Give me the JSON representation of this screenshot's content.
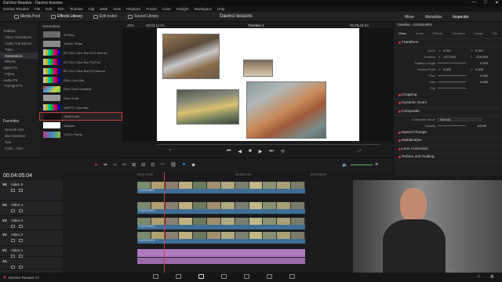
{
  "window": {
    "title": "DaVinci Resolve - Davinci lessons",
    "controls": [
      "—",
      "□",
      "✕"
    ]
  },
  "menu": [
    "DaVinci Resolve",
    "File",
    "Edit",
    "Trim",
    "Timeline",
    "Clip",
    "Mark",
    "View",
    "Playback",
    "Fusion",
    "Color",
    "Fairlight",
    "Workspace",
    "Help"
  ],
  "toolbar": {
    "media_pool": "Media Pool",
    "effects_library": "Effects Library",
    "edit_index": "Edit Index",
    "sound_library": "Sound Library",
    "project_title": "Davinci lessons",
    "mixer": "Mixer",
    "metadata": "Metadata",
    "inspector": "Inspector"
  },
  "left_panel": {
    "items": [
      {
        "label": "Toolbox",
        "sel": false,
        "head": true
      },
      {
        "label": "Video Transitions",
        "sel": false
      },
      {
        "label": "Audio Transitions",
        "sel": false
      },
      {
        "label": "Titles",
        "sel": false
      },
      {
        "label": "Generators",
        "sel": true
      },
      {
        "label": "Effects",
        "sel": false
      },
      {
        "label": "Open FX",
        "sel": false,
        "head": true
      },
      {
        "label": "Filters",
        "sel": false
      },
      {
        "label": "Audio FX",
        "sel": false,
        "head": true
      },
      {
        "label": "Fairlight FX",
        "sel": false
      }
    ],
    "favorites_title": "Favorites",
    "favorites": [
      "Smooth Cut",
      "Blur Dissolve",
      "Text",
      "Color...ction"
    ]
  },
  "generators": {
    "title": "Generators",
    "items": [
      {
        "label": "10 Step",
        "thumb": "#6a6a6a"
      },
      {
        "label": "100mV Steps",
        "thumb": "#8a8a8a"
      },
      {
        "label": "BT.2111 Color Bar HLG Narrow",
        "thumb": "bars"
      },
      {
        "label": "BT.2111 Color Bar PQ Full",
        "thumb": "bars"
      },
      {
        "label": "BT.2111 Color Bar PQ Narrow",
        "thumb": "bars"
      },
      {
        "label": "EBU Color Bar",
        "thumb": "bars"
      },
      {
        "label": "Four Color Gradient",
        "thumb": "grad"
      },
      {
        "label": "Grey Scale",
        "thumb": "#9a9a9a"
      },
      {
        "label": "SMPTE Color Bar",
        "thumb": "bars"
      },
      {
        "label": "Solid Color",
        "thumb": "#111111",
        "sel": true
      },
      {
        "label": "Window",
        "thumb": "#ffffff"
      },
      {
        "label": "YCbCr Ramp",
        "thumb": "grad2"
      }
    ]
  },
  "viewer": {
    "zoom": "40%",
    "source_timecode": "00:04:11:21",
    "timeline_name": "Timeline 1",
    "record_timecode": "00:05:04:04"
  },
  "inspector": {
    "clip_name": "Timeline - C0229.MP4",
    "tabs": [
      "Video",
      "Audio",
      "Effects",
      "Transition",
      "Image",
      "File"
    ],
    "transform_label": "Transform",
    "rows": [
      {
        "label": "Zoom",
        "x_lab": "X",
        "x": "0.310",
        "y_lab": "Y",
        "y": "0.310"
      },
      {
        "label": "Position",
        "x_lab": "X",
        "x": "-477.000",
        "y_lab": "Y",
        "y": "-226.000"
      },
      {
        "label": "Rotation Angle",
        "v": "0.000"
      },
      {
        "label": "Anchor Point",
        "x_lab": "X",
        "x": "0.000",
        "y_lab": "Y",
        "y": "0.000"
      },
      {
        "label": "Pitch",
        "v": "0.000"
      },
      {
        "label": "Yaw",
        "v": "0.000"
      },
      {
        "label": "Flip",
        "v": ""
      }
    ],
    "sections_mid": [
      "Cropping",
      "Dynamic Zoom"
    ],
    "composite_label": "Composite",
    "composite_mode_label": "Composite Mode",
    "composite_mode_value": "Normal",
    "opacity_label": "Opacity",
    "opacity_value": "100.00",
    "sections_after": [
      "Speed Change",
      "Stabilization",
      "Lens Correction",
      "Retime and Scaling"
    ]
  },
  "timeline": {
    "timecode": "00:04:05:04",
    "ruler_marks": [
      "00:04:00:00",
      "00:08:00:00",
      "00:12:00:00"
    ],
    "tracks": [
      {
        "id": "V5",
        "name": "Video 5"
      },
      {
        "id": "V4",
        "name": "Video 4"
      },
      {
        "id": "V3",
        "name": "Video 3"
      },
      {
        "id": "V2",
        "name": "Video 2"
      },
      {
        "id": "V1",
        "name": "Video 1"
      },
      {
        "id": "A1",
        "name": ""
      }
    ],
    "clips": [
      "C0229.MP4",
      "C0229.MP4",
      "C0229.MP4",
      "C0229.MP4"
    ]
  },
  "status": {
    "app": "DaVinci Resolve 17"
  },
  "colors": {
    "accent_red": "#d03b3b",
    "clip_blue": "#3f6e96",
    "clip_pink": "#b07ac0"
  }
}
